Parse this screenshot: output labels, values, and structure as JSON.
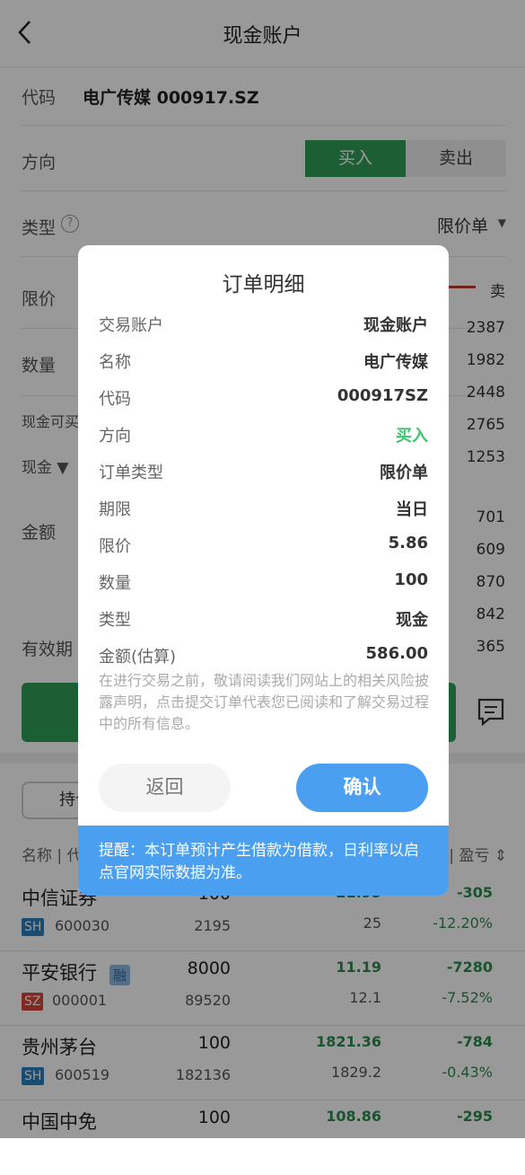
{
  "header": {
    "title": "现金账户",
    "back_icon": "chevron-left-icon"
  },
  "form": {
    "code_label": "代码",
    "code_value": "电广传媒 000917.SZ",
    "direction_label": "方向",
    "buy": "买入",
    "sell": "卖出",
    "type_label": "类型",
    "type_value": "限价单",
    "limit_label": "限价",
    "qty_label": "数量",
    "cash_buyable_label": "现金可买",
    "cash_select": "现金",
    "amount_label": "金额",
    "validity_label": "有效期"
  },
  "orderbook": {
    "sell_label": "卖",
    "volumes": [
      "2387",
      "1982",
      "2448",
      "2765",
      "1253",
      "701",
      "609",
      "870",
      "842",
      "365"
    ]
  },
  "holdings": {
    "tab": "持仓",
    "columns": [
      "名称 | 代码",
      "盈亏"
    ],
    "rows": [
      {
        "name": "中信证券",
        "market": "SH",
        "code": "600030",
        "qty": "100",
        "value": "2195",
        "price": "21.95",
        "cost": "25",
        "pl": "-305",
        "pl_pct": "-12.20%"
      },
      {
        "name": "平安银行",
        "badge": "融",
        "market": "SZ",
        "code": "000001",
        "qty": "8000",
        "value": "89520",
        "price": "11.19",
        "cost": "12.1",
        "pl": "-7280",
        "pl_pct": "-7.52%"
      },
      {
        "name": "贵州茅台",
        "market": "SH",
        "code": "600519",
        "qty": "100",
        "value": "182136",
        "price": "1821.36",
        "cost": "1829.2",
        "pl": "-784",
        "pl_pct": "-0.43%"
      },
      {
        "name": "中国中免",
        "qty": "100",
        "price": "108.86",
        "pl": "-295"
      }
    ]
  },
  "modal": {
    "title": "订单明细",
    "rows": [
      {
        "k": "交易账户",
        "v": "现金账户"
      },
      {
        "k": "名称",
        "v": "电广传媒"
      },
      {
        "k": "代码",
        "v": "000917SZ"
      },
      {
        "k": "方向",
        "v": "买入"
      },
      {
        "k": "订单类型",
        "v": "限价单"
      },
      {
        "k": "期限",
        "v": "当日"
      },
      {
        "k": "限价",
        "v": "5.86"
      },
      {
        "k": "数量",
        "v": "100"
      },
      {
        "k": "类型",
        "v": "现金"
      },
      {
        "k": "金额(估算)",
        "v": "586.00"
      }
    ],
    "disclaimer": "在进行交易之前，敬请阅读我们网站上的相关风险披露声明，点击提交订单代表您已阅读和了解交易过程中的所有信息。",
    "back": "返回",
    "confirm": "确认",
    "notice": "提醒：本订单预计产生借款为借款，日利率以启点官网实际数据为准。"
  },
  "colors": {
    "buy_green": "#2f9e57",
    "direction_green": "#3cc46e",
    "primary_blue": "#4a9ff0",
    "sh_blue": "#2a7fc0",
    "sz_red": "#d9463a"
  }
}
